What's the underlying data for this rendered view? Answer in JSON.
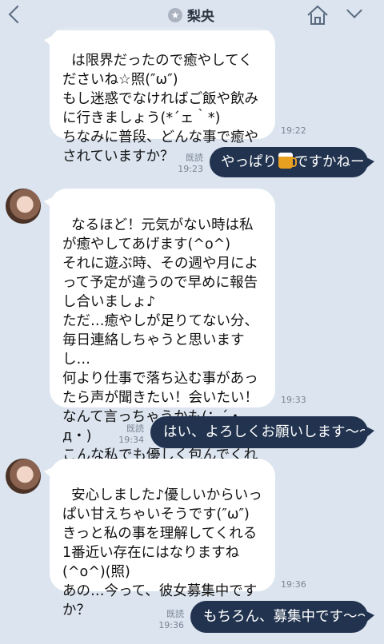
{
  "header": {
    "title": "梨央",
    "star_glyph": "★"
  },
  "messages": {
    "m1": {
      "text_top": "は限界だったので癒やしてくださいね☆照(″ω″)\nもし迷惑でなければご飯や飲みに行きましょう(*´ェ｀*)\nちなみに普段、どんな事で癒やされていますか？",
      "time": "19:22"
    },
    "m2": {
      "text_before": "やっぱり",
      "icon": "beer-icon",
      "text_after": "ですかねー",
      "read_label": "既読",
      "time": "19:23"
    },
    "m3": {
      "text": "なるほど！元気がない時は私が癒やしてあげます(^o^)\nそれに遊ぶ時、その週や月によって予定が違うので早めに報告し合いましょ♪\nただ…癒やしが足りてない分、毎日連絡しちゃうと思いますし…\n何より仕事で落ち込む事があったら声が聞きたい！会いたい！なんて言っちゃうかも(；´・д・)\nこんな私でも優しく包んでくれますか？",
      "time": "19:33"
    },
    "m4": {
      "text": "はい、よろしくお願いします〜〜",
      "read_label": "既読",
      "time": "19:34"
    },
    "m5": {
      "text": "安心しました♪優しいからいっぱい甘えちゃいそうです(″ω″)\nきっと私の事を理解してくれる1番近い存在にはなりますね(^o^)(照)\nあの…今って、彼女募集中ですか？",
      "time": "19:36"
    },
    "m6": {
      "text": "もちろん、募集中です〜〜",
      "read_label": "既読",
      "time": "19:36"
    }
  }
}
